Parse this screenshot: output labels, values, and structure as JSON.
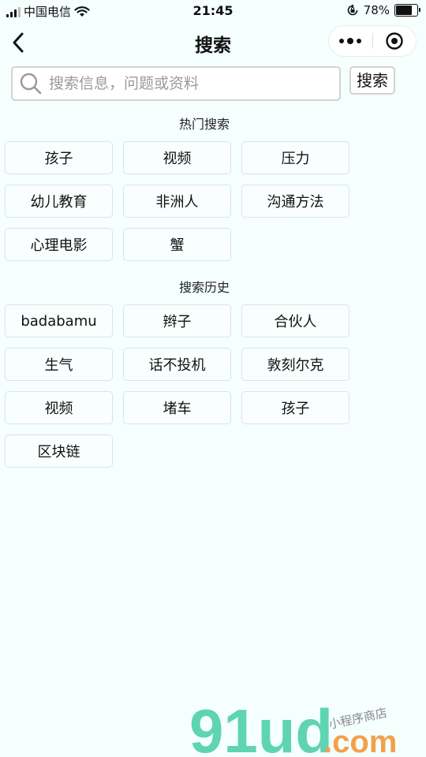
{
  "status_bar": {
    "carrier": "中国电信",
    "time": "21:45",
    "battery_percent": "78%",
    "battery_level": 0.78,
    "icons": [
      "signal-icon",
      "wifi-icon",
      "orientation-lock-icon",
      "battery-icon"
    ]
  },
  "nav": {
    "title": "搜索",
    "back_icon": "chevron-left-icon",
    "more_icon": "more-dots-icon",
    "close_icon": "target-close-icon"
  },
  "search": {
    "placeholder": "搜索信息，问题或资料",
    "value": "",
    "button_label": "搜索",
    "icon": "search-icon"
  },
  "hot": {
    "title": "热门搜索",
    "items": [
      "孩子",
      "视频",
      "压力",
      "幼儿教育",
      "非洲人",
      "沟通方法",
      "心理电影",
      "蟹"
    ]
  },
  "history": {
    "title": "搜索历史",
    "items": [
      "badabamu",
      "辫子",
      "合伙人",
      "生气",
      "话不投机",
      "敦刻尔克",
      "视频",
      "堵车",
      "孩子",
      "区块链"
    ]
  },
  "watermark": {
    "logo_text": "91ud",
    "domain_text": ".com",
    "tagline": "小程序商店",
    "colors": {
      "logo": "#5fd4b0",
      "domain": "#f4a04a"
    }
  }
}
